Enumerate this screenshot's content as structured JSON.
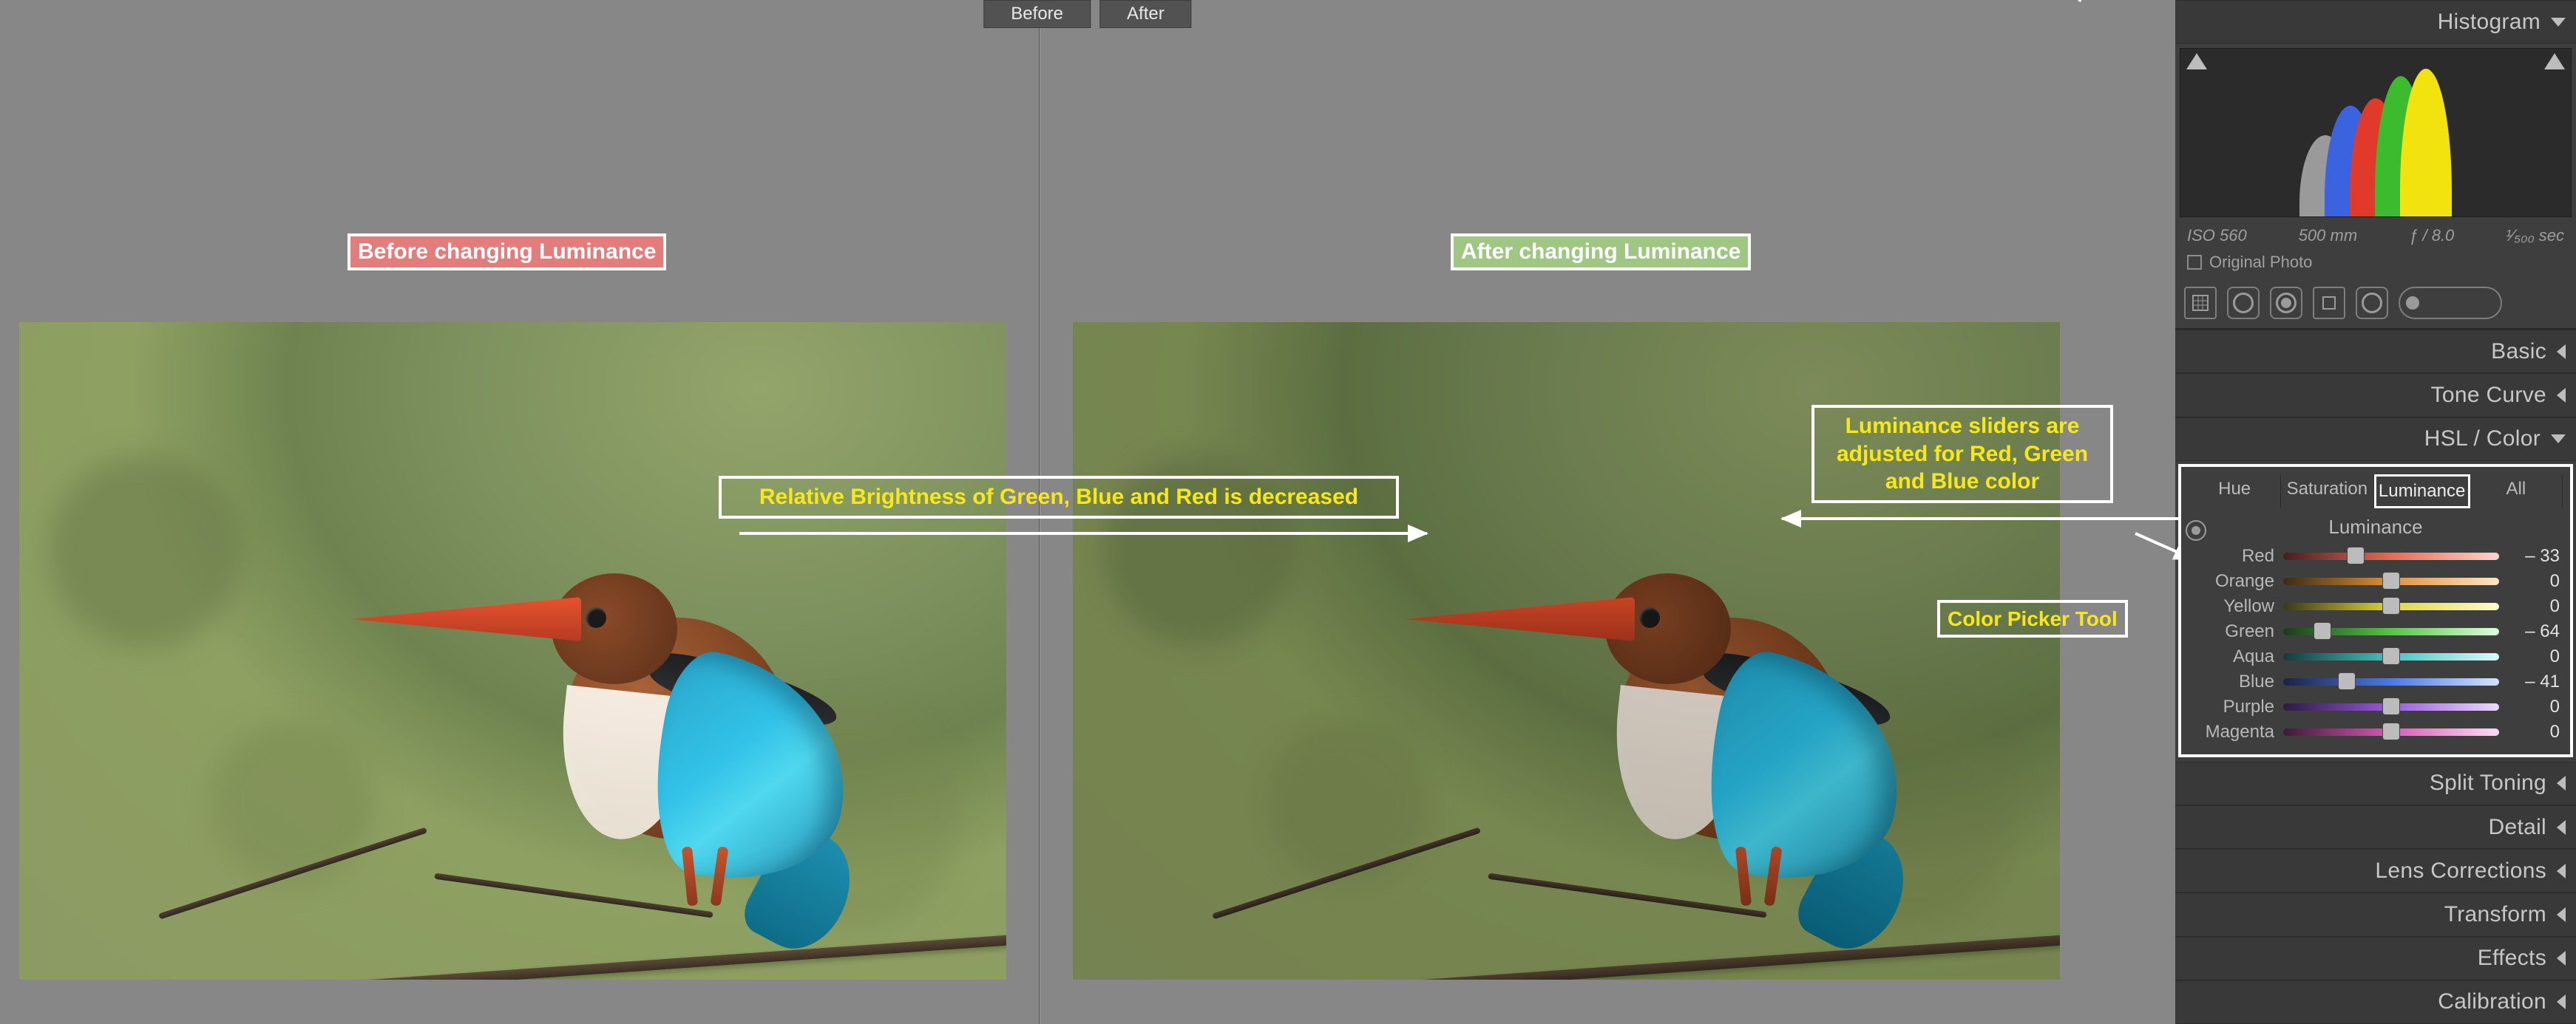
{
  "tabs": {
    "before": "Before",
    "after": "After"
  },
  "labels": {
    "before": "Before changing Luminance",
    "after": "After changing Luminance"
  },
  "annotations": {
    "main": "Relative Brightness of Green, Blue and Red is decreased",
    "sliders_line1": "Luminance sliders are",
    "sliders_line2": "adjusted for Red, Green",
    "sliders_line3": "and Blue color",
    "picker": "Color Picker Tool"
  },
  "panel": {
    "histogram": "Histogram",
    "exif": {
      "iso": "ISO 560",
      "focal": "500 mm",
      "aperture": "ƒ / 8.0",
      "shutter": "¹⁄₅₀₀ sec"
    },
    "original": "Original Photo",
    "groups": {
      "basic": "Basic",
      "tone": "Tone Curve",
      "hsl": "HSL / Color",
      "split": "Split Toning",
      "detail": "Detail",
      "lens": "Lens Corrections",
      "trans": "Transform",
      "fx": "Effects",
      "calib": "Calibration"
    },
    "hsl_tabs": {
      "hue": "Hue",
      "sat": "Saturation",
      "lum": "Luminance",
      "all": "All"
    },
    "lum_title": "Luminance",
    "sliders": [
      {
        "name": "Red",
        "value": -33,
        "class": "g-red"
      },
      {
        "name": "Orange",
        "value": 0,
        "class": "g-orange"
      },
      {
        "name": "Yellow",
        "value": 0,
        "class": "g-yellow"
      },
      {
        "name": "Green",
        "value": -64,
        "class": "g-green"
      },
      {
        "name": "Aqua",
        "value": 0,
        "class": "g-aqua"
      },
      {
        "name": "Blue",
        "value": -41,
        "class": "g-blue"
      },
      {
        "name": "Purple",
        "value": 0,
        "class": "g-purple"
      },
      {
        "name": "Magenta",
        "value": 0,
        "class": "g-magenta"
      }
    ]
  }
}
